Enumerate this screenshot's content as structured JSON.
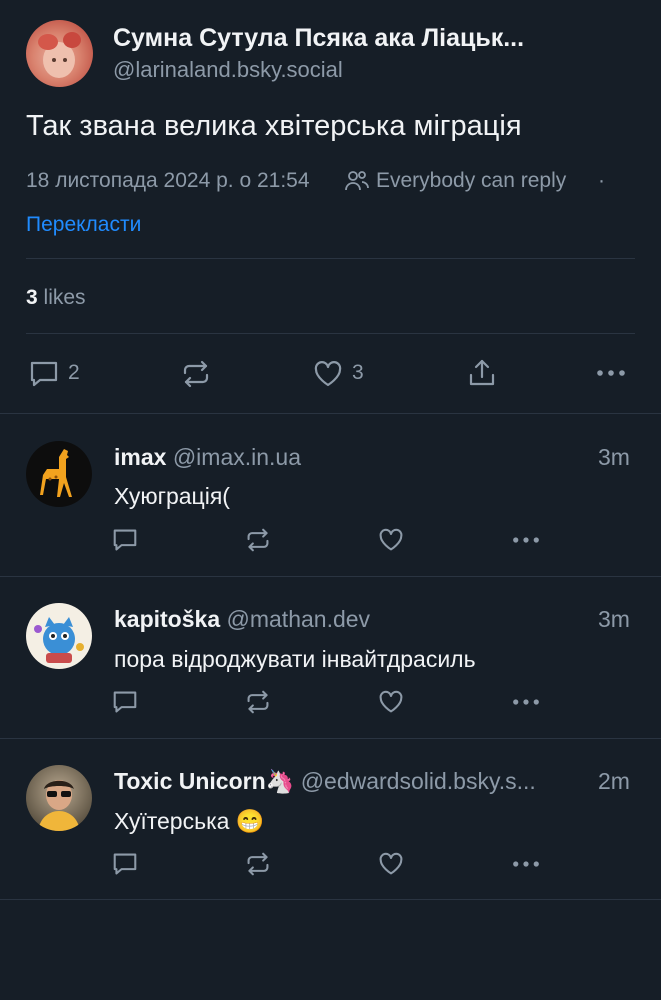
{
  "post": {
    "author_name": "Сумна Сутула Псяка ака Ліацьк...",
    "author_handle": "@larinaland.bsky.social",
    "text": "Так звана велика хвітерська міграція",
    "timestamp": "18 листопада 2024 р. о 21:54",
    "reply_setting": "Everybody can reply",
    "separator": "·",
    "translate_label": "Перекласти",
    "likes_count": "3",
    "likes_label": "likes",
    "actions": {
      "reply_count": "2",
      "like_count": "3"
    }
  },
  "replies": [
    {
      "name": "imax",
      "handle": "@imax.in.ua",
      "time": "3m",
      "text": "Хуюграція("
    },
    {
      "name": "kapitoška",
      "handle": "@mathan.dev",
      "time": "3m",
      "text": "пора відроджувати інвайтдрасиль"
    },
    {
      "name": "Toxic Unicorn🦄",
      "handle": "@edwardsolid.bsky.s...",
      "time": "2m",
      "text": "Хуїтерська 😁"
    }
  ]
}
